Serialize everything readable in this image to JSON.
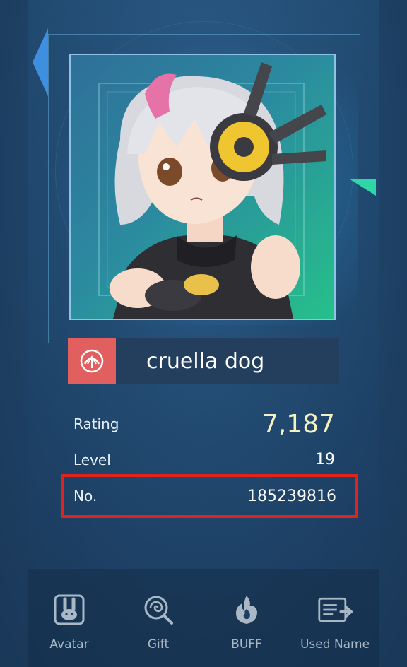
{
  "profile": {
    "name": "cruella dog",
    "emblem_icon": "shell-emblem-icon",
    "avatar_icon": "anime-girl-avatar"
  },
  "stats": {
    "rating_label": "Rating",
    "rating_value": "7,187",
    "level_label": "Level",
    "level_value": "19",
    "no_label": "No.",
    "no_value": "185239816"
  },
  "nav": [
    {
      "label": "Avatar",
      "icon": "rabbit-icon"
    },
    {
      "label": "Gift",
      "icon": "lollipop-icon"
    },
    {
      "label": "BUFF",
      "icon": "flame-icon"
    },
    {
      "label": "Used Name",
      "icon": "id-card-icon"
    }
  ],
  "colors": {
    "emblem_bg": "#e25f5f",
    "rating_value": "#f4f1c2",
    "highlight_border": "#e0231c",
    "accent_arrow": "#3f8fe0",
    "accent_triangle": "#2fd6a6"
  }
}
